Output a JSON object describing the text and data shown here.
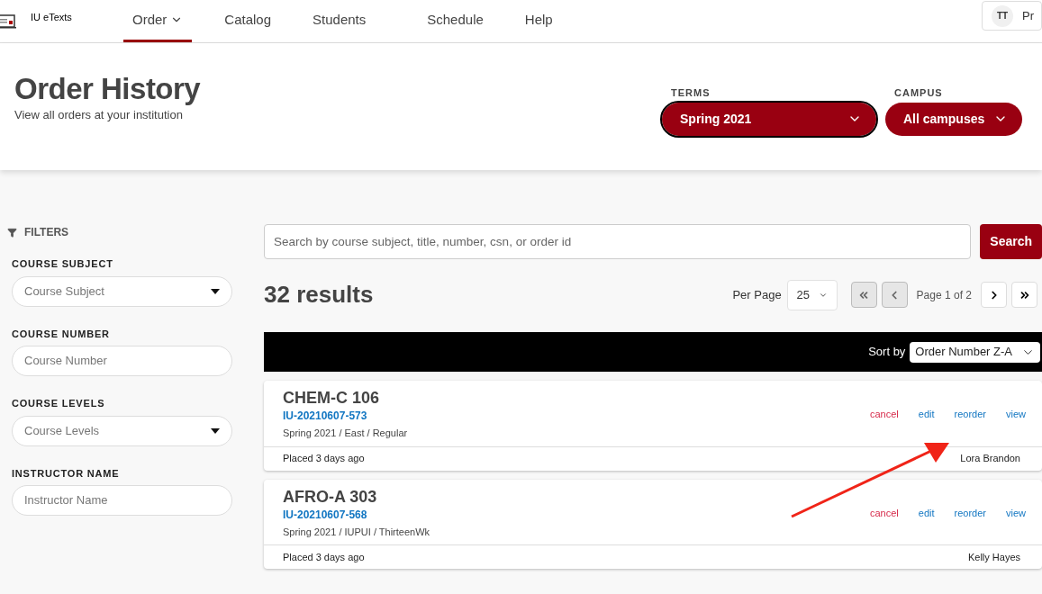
{
  "brand": {
    "name": "IU eTexts"
  },
  "nav": [
    {
      "label": "Order",
      "selected": true,
      "dropdown": true
    },
    {
      "label": "Catalog",
      "selected": false,
      "dropdown": false
    },
    {
      "label": "Students",
      "selected": false,
      "dropdown": false
    },
    {
      "label": "Schedule",
      "selected": false,
      "dropdown": false
    },
    {
      "label": "Help",
      "selected": false,
      "dropdown": false
    }
  ],
  "user": {
    "initials": "TT",
    "label": "Pr"
  },
  "header": {
    "title": "Order History",
    "subtitle": "View all orders at your institution"
  },
  "selectors": [
    {
      "label": "TERMS",
      "value": "Spring 2021",
      "focused": true
    },
    {
      "label": "CAMPUS",
      "value": "All campuses",
      "focused": false
    }
  ],
  "filters": {
    "title": "FILTERS",
    "fields": [
      {
        "label": "COURSE SUBJECT",
        "placeholder": "Course Subject",
        "kind": "select"
      },
      {
        "label": "COURSE NUMBER",
        "placeholder": "Course Number",
        "kind": "text"
      },
      {
        "label": "COURSE LEVELS",
        "placeholder": "Course Levels",
        "kind": "select"
      },
      {
        "label": "INSTRUCTOR NAME",
        "placeholder": "Instructor Name",
        "kind": "text"
      }
    ]
  },
  "search": {
    "placeholder": "Search by course subject, title, number, csn, or order id",
    "button": "Search"
  },
  "results": {
    "count": "32 results",
    "per_page_label": "Per Page",
    "per_page": "25",
    "page_label": "Page 1 of 2",
    "pager": [
      {
        "kind": "first",
        "disabled": true
      },
      {
        "kind": "prev",
        "disabled": true
      },
      {
        "kind": "next",
        "disabled": false
      },
      {
        "kind": "last",
        "disabled": false
      }
    ]
  },
  "sort": {
    "label": "Sort by",
    "value": "Order Number Z-A"
  },
  "orders": [
    {
      "course": "CHEM-C 106",
      "order_id": "IU-20210607-573",
      "details": "Spring 2021 / East / Regular",
      "placed": "Placed 3 days ago",
      "instructor": "Lora Brandon",
      "actions": [
        {
          "label": "cancel",
          "kind": "danger"
        },
        {
          "label": "edit",
          "kind": "link"
        },
        {
          "label": "reorder",
          "kind": "link"
        },
        {
          "label": "view",
          "kind": "link"
        }
      ]
    },
    {
      "course": "AFRO-A 303",
      "order_id": "IU-20210607-568",
      "details": "Spring 2021 / IUPUI / ThirteenWk",
      "placed": "Placed 3 days ago",
      "instructor": "Kelly Hayes",
      "actions": [
        {
          "label": "cancel",
          "kind": "danger"
        },
        {
          "label": "edit",
          "kind": "link"
        },
        {
          "label": "reorder",
          "kind": "link"
        },
        {
          "label": "view",
          "kind": "link"
        }
      ]
    }
  ]
}
